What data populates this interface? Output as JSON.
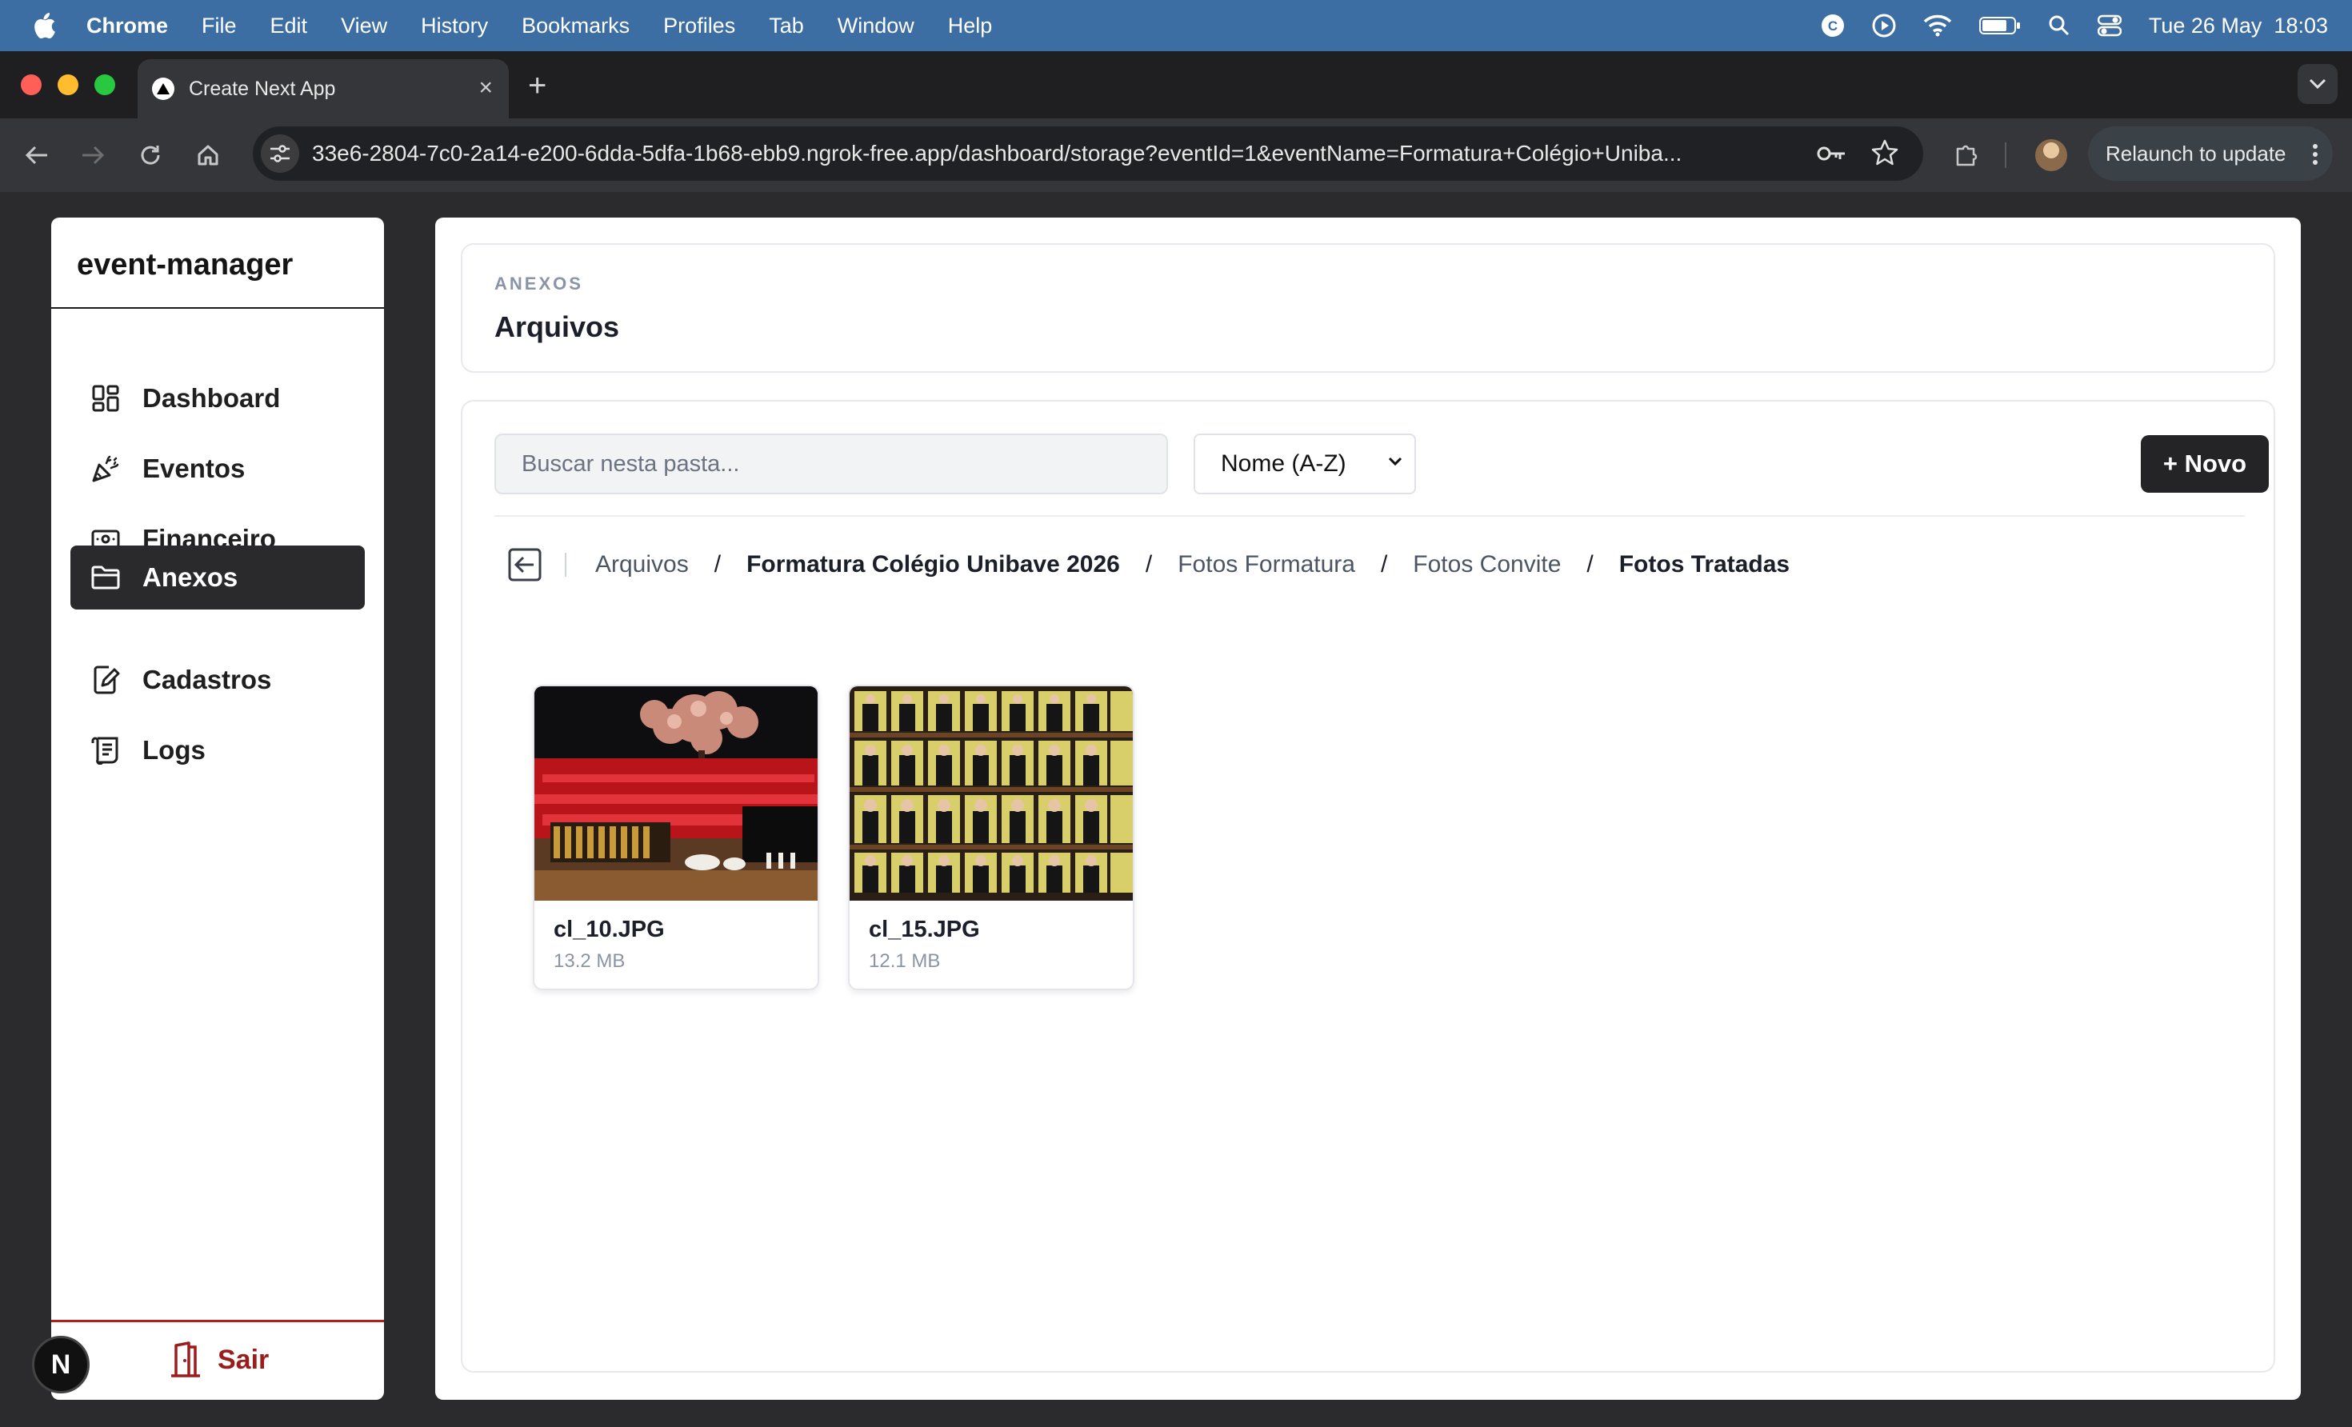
{
  "system_menubar": {
    "app_name": "Chrome",
    "menus": [
      "File",
      "Edit",
      "View",
      "History",
      "Bookmarks",
      "Profiles",
      "Tab",
      "Window",
      "Help"
    ],
    "clock": "Tue 26 May  18:03"
  },
  "browser": {
    "tab_title": "Create Next App",
    "url": "33e6-2804-7c0-2a14-e200-6dda-5dfa-1b68-ebb9.ngrok-free.app/dashboard/storage?eventId=1&eventName=Formatura+Colégio+Uniba...",
    "relaunch_label": "Relaunch to update"
  },
  "sidebar": {
    "brand": "event-manager",
    "items": [
      {
        "label": "Dashboard",
        "icon": "dashboard-icon"
      },
      {
        "label": "Eventos",
        "icon": "party-popper-icon"
      },
      {
        "label": "Financeiro",
        "icon": "banknote-icon"
      },
      {
        "label": "Anexos",
        "icon": "folder-icon",
        "active": true
      },
      {
        "label": "Cadastros",
        "icon": "edit-document-icon"
      },
      {
        "label": "Logs",
        "icon": "scroll-icon"
      }
    ],
    "logout_label": "Sair",
    "next_badge": "N"
  },
  "header": {
    "eyebrow": "ANEXOS",
    "title": "Arquivos"
  },
  "toolbar": {
    "search_placeholder": "Buscar nesta pasta...",
    "sort_selected": "Nome (A-Z)",
    "new_label": "+ Novo"
  },
  "breadcrumb": {
    "items": [
      "Arquivos",
      "Formatura Colégio Unibave 2026",
      "Fotos Formatura",
      "Fotos Convite",
      "Fotos Tratadas"
    ],
    "separator": "/"
  },
  "files": [
    {
      "name": "cl_10.JPG",
      "size": "13.2 MB"
    },
    {
      "name": "cl_15.JPG",
      "size": "12.1 MB"
    }
  ],
  "colors": {
    "accent_dark": "#242426",
    "logout_red": "#9b1c1c",
    "menubar_blue": "#3d6ea3"
  }
}
